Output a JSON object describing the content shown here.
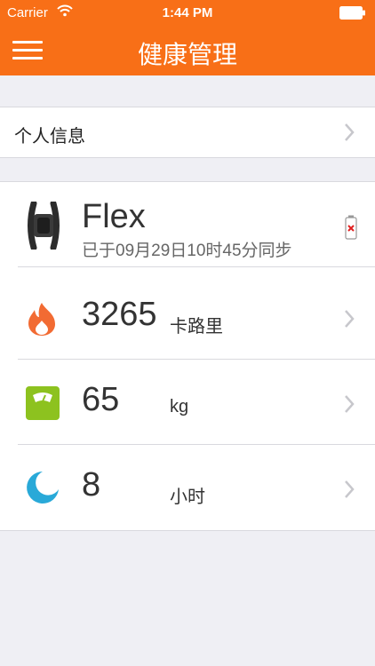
{
  "status": {
    "carrier": "Carrier",
    "time": "1:44 PM"
  },
  "nav": {
    "title": "健康管理"
  },
  "profile": {
    "label": "个人信息"
  },
  "device": {
    "name": "Flex",
    "sync": "已于09月29日10时45分同步"
  },
  "stats": [
    {
      "value": "3265",
      "unit": "卡路里"
    },
    {
      "value": "65",
      "unit": "kg"
    },
    {
      "value": "8",
      "unit": "小时"
    }
  ],
  "colors": {
    "accent": "#f86f17",
    "flame": "#f26b33",
    "scale": "#8dc21f",
    "moon": "#29a9d8"
  }
}
